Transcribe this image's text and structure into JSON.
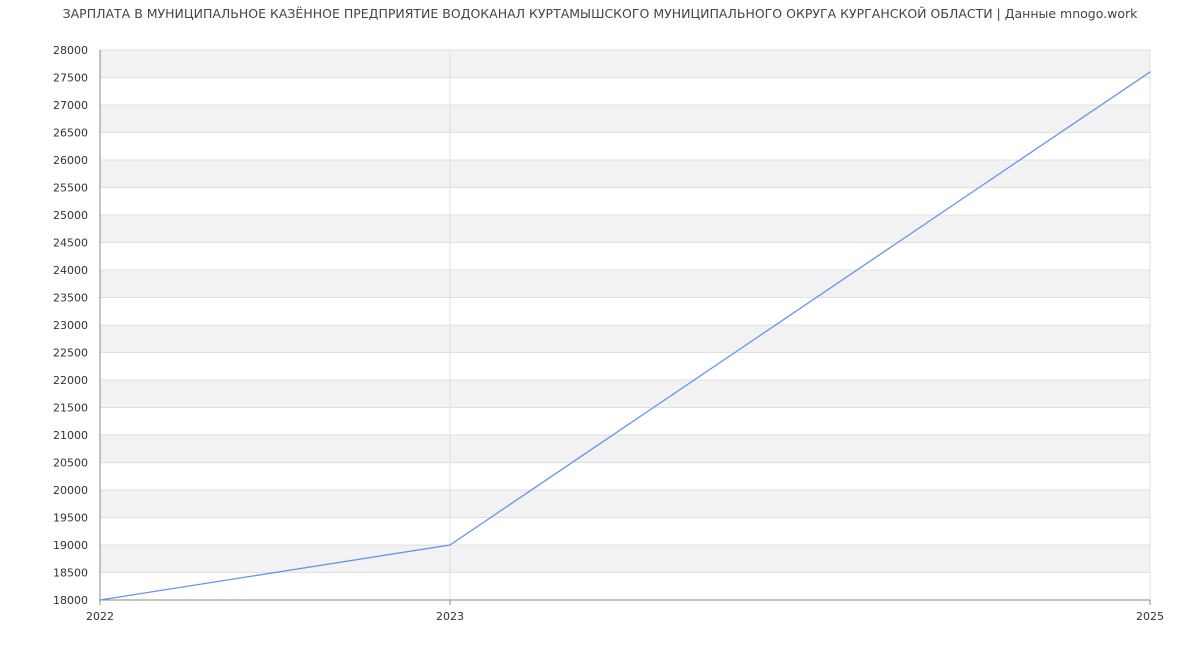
{
  "chart_data": {
    "type": "line",
    "title": "ЗАРПЛАТА В МУНИЦИПАЛЬНОЕ КАЗЁННОЕ ПРЕДПРИЯТИЕ ВОДОКАНАЛ КУРТАМЫШСКОГО МУНИЦИПАЛЬНОГО ОКРУГА КУРГАНСКОЙ ОБЛАСТИ | Данные mnogo.work",
    "xlabel": "",
    "ylabel": "",
    "x": [
      "2022",
      "2023",
      "2025"
    ],
    "series": [
      {
        "values": [
          18000,
          19000,
          27600
        ],
        "color": "#6495ed"
      }
    ],
    "ylim": [
      18000,
      28000
    ],
    "y_ticks": [
      "18000",
      "18500",
      "19000",
      "19500",
      "20000",
      "20500",
      "21000",
      "21500",
      "22000",
      "22500",
      "23000",
      "23500",
      "24000",
      "24500",
      "25000",
      "25500",
      "26000",
      "26500",
      "27000",
      "27500",
      "28000"
    ],
    "grid": true,
    "band_color": "#f2f2f2",
    "grid_color": "#e0e0e0",
    "axis_color": "#888888"
  }
}
